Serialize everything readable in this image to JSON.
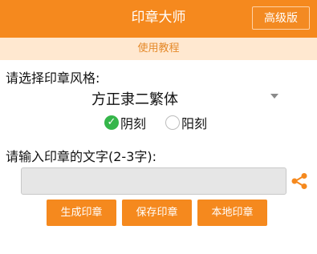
{
  "header": {
    "title": "印章大师",
    "pro_label": "高级版"
  },
  "tutorial": {
    "label": "使用教程"
  },
  "style": {
    "label": "请选择印章风格:",
    "selected_font": "方正隶二繁体",
    "options": [
      {
        "label": "阴刻",
        "checked": true
      },
      {
        "label": "阳刻",
        "checked": false
      }
    ]
  },
  "text_entry": {
    "label": "请输入印章的文字(2-3字):",
    "value": ""
  },
  "buttons": {
    "generate": "生成印章",
    "save": "保存印章",
    "local": "本地印章"
  },
  "colors": {
    "accent": "#f5891e",
    "check": "#35b64a",
    "tutorial_bg": "#ffe8d0"
  },
  "icons": {
    "share": "share-icon",
    "dropdown": "dropdown-arrow-icon"
  }
}
